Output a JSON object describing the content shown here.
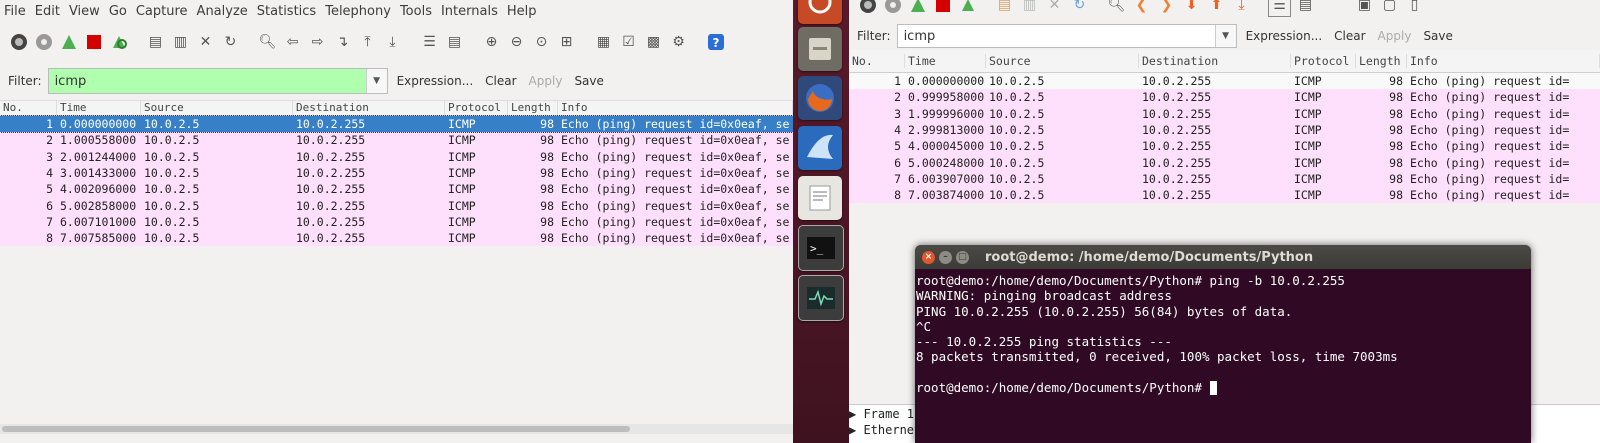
{
  "left": {
    "menu": [
      "File",
      "Edit",
      "View",
      "Go",
      "Capture",
      "Analyze",
      "Statistics",
      "Telephony",
      "Tools",
      "Internals",
      "Help"
    ],
    "filter": {
      "label": "Filter:",
      "value": "icmp",
      "expression": "Expression...",
      "clear": "Clear",
      "apply": "Apply",
      "save": "Save"
    },
    "columns": [
      "No.",
      "Time",
      "Source",
      "Destination",
      "Protocol",
      "Length",
      "Info"
    ],
    "rows": [
      {
        "no": "1",
        "time": "0.000000000",
        "src": "10.0.2.5",
        "dst": "10.0.2.255",
        "proto": "ICMP",
        "len": "98",
        "info": "Echo (ping) request  id=0x0eaf, se"
      },
      {
        "no": "2",
        "time": "1.000558000",
        "src": "10.0.2.5",
        "dst": "10.0.2.255",
        "proto": "ICMP",
        "len": "98",
        "info": "Echo (ping) request  id=0x0eaf, se"
      },
      {
        "no": "3",
        "time": "2.001244000",
        "src": "10.0.2.5",
        "dst": "10.0.2.255",
        "proto": "ICMP",
        "len": "98",
        "info": "Echo (ping) request  id=0x0eaf, se"
      },
      {
        "no": "4",
        "time": "3.001433000",
        "src": "10.0.2.5",
        "dst": "10.0.2.255",
        "proto": "ICMP",
        "len": "98",
        "info": "Echo (ping) request  id=0x0eaf, se"
      },
      {
        "no": "5",
        "time": "4.002096000",
        "src": "10.0.2.5",
        "dst": "10.0.2.255",
        "proto": "ICMP",
        "len": "98",
        "info": "Echo (ping) request  id=0x0eaf, se"
      },
      {
        "no": "6",
        "time": "5.002858000",
        "src": "10.0.2.5",
        "dst": "10.0.2.255",
        "proto": "ICMP",
        "len": "98",
        "info": "Echo (ping) request  id=0x0eaf, se"
      },
      {
        "no": "7",
        "time": "6.007101000",
        "src": "10.0.2.5",
        "dst": "10.0.2.255",
        "proto": "ICMP",
        "len": "98",
        "info": "Echo (ping) request  id=0x0eaf, se"
      },
      {
        "no": "8",
        "time": "7.007585000",
        "src": "10.0.2.5",
        "dst": "10.0.2.255",
        "proto": "ICMP",
        "len": "98",
        "info": "Echo (ping) request  id=0x0eaf, se"
      }
    ]
  },
  "right": {
    "filter": {
      "label": "Filter:",
      "value": "icmp",
      "expression": "Expression...",
      "clear": "Clear",
      "apply": "Apply",
      "save": "Save"
    },
    "columns": [
      "No.",
      "Time",
      "Source",
      "Destination",
      "Protocol",
      "Length",
      "Info"
    ],
    "rows": [
      {
        "no": "1",
        "time": "0.000000000",
        "src": "10.0.2.5",
        "dst": "10.0.2.255",
        "proto": "ICMP",
        "len": "98",
        "info": "Echo (ping) request  id="
      },
      {
        "no": "2",
        "time": "0.999958000",
        "src": "10.0.2.5",
        "dst": "10.0.2.255",
        "proto": "ICMP",
        "len": "98",
        "info": "Echo (ping) request  id="
      },
      {
        "no": "3",
        "time": "1.999996000",
        "src": "10.0.2.5",
        "dst": "10.0.2.255",
        "proto": "ICMP",
        "len": "98",
        "info": "Echo (ping) request  id="
      },
      {
        "no": "4",
        "time": "2.999813000",
        "src": "10.0.2.5",
        "dst": "10.0.2.255",
        "proto": "ICMP",
        "len": "98",
        "info": "Echo (ping) request  id="
      },
      {
        "no": "5",
        "time": "4.000045000",
        "src": "10.0.2.5",
        "dst": "10.0.2.255",
        "proto": "ICMP",
        "len": "98",
        "info": "Echo (ping) request  id="
      },
      {
        "no": "6",
        "time": "5.000248000",
        "src": "10.0.2.5",
        "dst": "10.0.2.255",
        "proto": "ICMP",
        "len": "98",
        "info": "Echo (ping) request  id="
      },
      {
        "no": "7",
        "time": "6.003907000",
        "src": "10.0.2.5",
        "dst": "10.0.2.255",
        "proto": "ICMP",
        "len": "98",
        "info": "Echo (ping) request  id="
      },
      {
        "no": "8",
        "time": "7.003874000",
        "src": "10.0.2.5",
        "dst": "10.0.2.255",
        "proto": "ICMP",
        "len": "98",
        "info": "Echo (ping) request  id="
      }
    ],
    "details": [
      "▶ Frame 1:",
      "▶ Ethernet"
    ]
  },
  "terminal": {
    "title": "root@demo: /home/demo/Documents/Python",
    "lines": [
      "root@demo:/home/demo/Documents/Python# ping -b 10.0.2.255",
      "WARNING: pinging broadcast address",
      "PING 10.0.2.255 (10.0.2.255) 56(84) bytes of data.",
      "^C",
      "--- 10.0.2.255 ping statistics ---",
      "8 packets transmitted, 0 received, 100% packet loss, time 7003ms",
      "",
      "root@demo:/home/demo/Documents/Python# "
    ]
  },
  "launcher": {
    "icons": [
      "ubuntu-icon",
      "files-icon",
      "firefox-icon",
      "wireshark-icon",
      "text-editor-icon",
      "terminal-icon",
      "system-monitor-icon"
    ]
  },
  "colors": {
    "row_bg": "#ffe0fc",
    "selected_row": "#3780c7",
    "filter_ok": "#afffaf",
    "terminal_bg": "#300a24",
    "launcher_bg": "#4a1525"
  }
}
